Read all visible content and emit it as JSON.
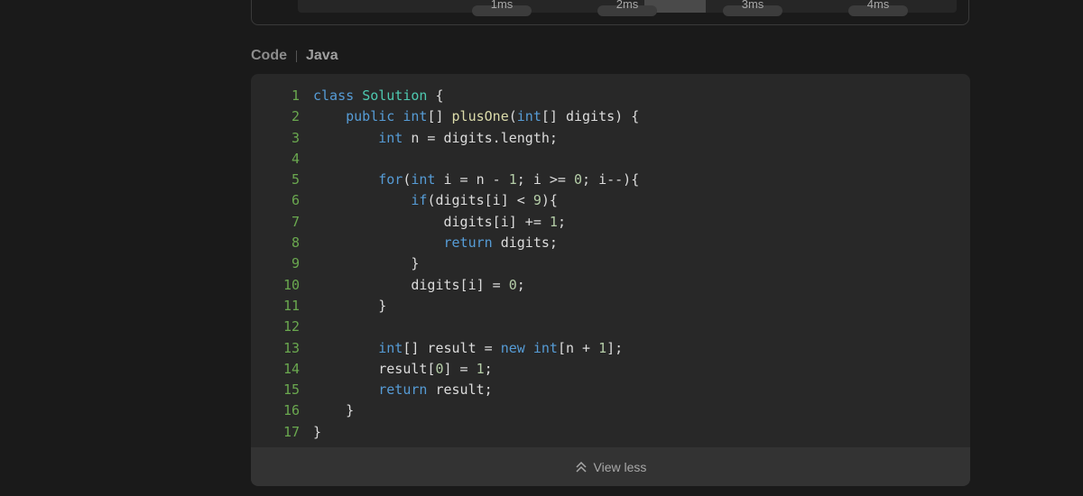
{
  "chart": {
    "ticks": [
      "1ms",
      "2ms",
      "3ms",
      "4ms"
    ]
  },
  "code_section": {
    "title": "Code",
    "language": "Java",
    "lines": [
      {
        "num": "1",
        "tokens": [
          {
            "t": "kw",
            "v": "class"
          },
          {
            "t": "pl",
            "v": " "
          },
          {
            "t": "cls",
            "v": "Solution"
          },
          {
            "t": "pl",
            "v": " {"
          }
        ]
      },
      {
        "num": "2",
        "tokens": [
          {
            "t": "pl",
            "v": "    "
          },
          {
            "t": "kw",
            "v": "public"
          },
          {
            "t": "pl",
            "v": " "
          },
          {
            "t": "kw",
            "v": "int"
          },
          {
            "t": "pl",
            "v": "[] "
          },
          {
            "t": "fn",
            "v": "plusOne"
          },
          {
            "t": "pl",
            "v": "("
          },
          {
            "t": "kw",
            "v": "int"
          },
          {
            "t": "pl",
            "v": "[] digits) {"
          }
        ]
      },
      {
        "num": "3",
        "tokens": [
          {
            "t": "pl",
            "v": "        "
          },
          {
            "t": "kw",
            "v": "int"
          },
          {
            "t": "pl",
            "v": " n = digits.length;"
          }
        ]
      },
      {
        "num": "4",
        "tokens": []
      },
      {
        "num": "5",
        "tokens": [
          {
            "t": "pl",
            "v": "        "
          },
          {
            "t": "kw",
            "v": "for"
          },
          {
            "t": "pl",
            "v": "("
          },
          {
            "t": "kw",
            "v": "int"
          },
          {
            "t": "pl",
            "v": " i = n - "
          },
          {
            "t": "num",
            "v": "1"
          },
          {
            "t": "pl",
            "v": "; i >= "
          },
          {
            "t": "num",
            "v": "0"
          },
          {
            "t": "pl",
            "v": "; i--){"
          }
        ]
      },
      {
        "num": "6",
        "tokens": [
          {
            "t": "pl",
            "v": "            "
          },
          {
            "t": "kw",
            "v": "if"
          },
          {
            "t": "pl",
            "v": "(digits[i] < "
          },
          {
            "t": "num",
            "v": "9"
          },
          {
            "t": "pl",
            "v": "){"
          }
        ]
      },
      {
        "num": "7",
        "tokens": [
          {
            "t": "pl",
            "v": "                digits[i] += "
          },
          {
            "t": "num",
            "v": "1"
          },
          {
            "t": "pl",
            "v": ";"
          }
        ]
      },
      {
        "num": "8",
        "tokens": [
          {
            "t": "pl",
            "v": "                "
          },
          {
            "t": "kw",
            "v": "return"
          },
          {
            "t": "pl",
            "v": " digits;"
          }
        ]
      },
      {
        "num": "9",
        "tokens": [
          {
            "t": "pl",
            "v": "            }"
          }
        ]
      },
      {
        "num": "10",
        "tokens": [
          {
            "t": "pl",
            "v": "            digits[i] = "
          },
          {
            "t": "num",
            "v": "0"
          },
          {
            "t": "pl",
            "v": ";"
          }
        ]
      },
      {
        "num": "11",
        "tokens": [
          {
            "t": "pl",
            "v": "        }"
          }
        ]
      },
      {
        "num": "12",
        "tokens": []
      },
      {
        "num": "13",
        "tokens": [
          {
            "t": "pl",
            "v": "        "
          },
          {
            "t": "kw",
            "v": "int"
          },
          {
            "t": "pl",
            "v": "[] result = "
          },
          {
            "t": "kw",
            "v": "new"
          },
          {
            "t": "pl",
            "v": " "
          },
          {
            "t": "kw",
            "v": "int"
          },
          {
            "t": "pl",
            "v": "[n + "
          },
          {
            "t": "num",
            "v": "1"
          },
          {
            "t": "pl",
            "v": "];"
          }
        ]
      },
      {
        "num": "14",
        "tokens": [
          {
            "t": "pl",
            "v": "        result["
          },
          {
            "t": "num",
            "v": "0"
          },
          {
            "t": "pl",
            "v": "] = "
          },
          {
            "t": "num",
            "v": "1"
          },
          {
            "t": "pl",
            "v": ";"
          }
        ]
      },
      {
        "num": "15",
        "tokens": [
          {
            "t": "pl",
            "v": "        "
          },
          {
            "t": "kw",
            "v": "return"
          },
          {
            "t": "pl",
            "v": " result;"
          }
        ]
      },
      {
        "num": "16",
        "tokens": [
          {
            "t": "pl",
            "v": "    }"
          }
        ]
      },
      {
        "num": "17",
        "tokens": [
          {
            "t": "pl",
            "v": "}"
          }
        ]
      }
    ],
    "view_less_label": "View less",
    "view_less_icon": "double-chevron-up-icon"
  },
  "colors": {
    "background": "#1a1a1a",
    "code_background": "#282828",
    "keyword": "#569cd6",
    "class_name": "#4ec9b0",
    "function_name": "#dcdcaa",
    "number": "#b5cea8",
    "line_number": "#6aa84f"
  }
}
